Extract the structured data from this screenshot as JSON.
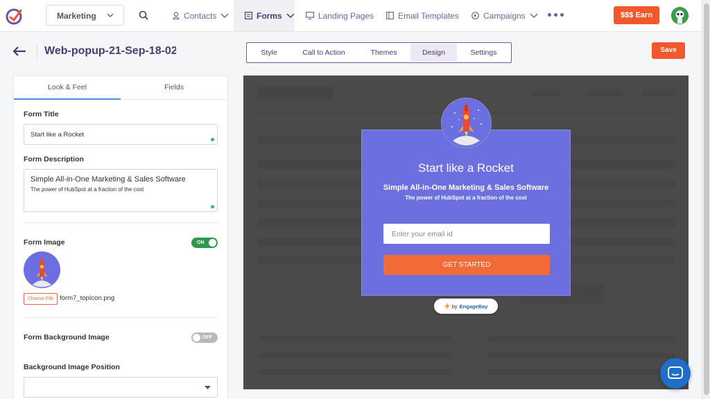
{
  "nav": {
    "workspace": "Marketing",
    "items": [
      {
        "label": "Contacts",
        "icon": "person-icon"
      },
      {
        "label": "Forms",
        "icon": "form-icon"
      },
      {
        "label": "Landing Pages",
        "icon": "monitor-icon"
      },
      {
        "label": "Email Templates",
        "icon": "template-icon"
      },
      {
        "label": "Campaigns",
        "icon": "campaign-icon"
      }
    ],
    "earn_label": "$$$ Earn"
  },
  "header": {
    "title": "Web-popup-21-Sep-18-02...",
    "tabs": [
      "Style",
      "Call to Action",
      "Themes",
      "Design",
      "Settings"
    ],
    "active_tab": "Design",
    "save_label": "Save"
  },
  "panel": {
    "tabs": [
      "Look & Feel",
      "Fields"
    ],
    "form_title_label": "Form Title",
    "form_title_value": "Start like a Rocket",
    "form_desc_label": "Form Description",
    "form_desc_line1": "Simple All-in-One Marketing & Sales Software",
    "form_desc_line2": "The power of HubSpot at a fraction of the cost",
    "form_image_label": "Form Image",
    "form_image_toggle": "ON",
    "choose_file_label": "Choose File",
    "file_name": "form7_topIcon.png",
    "bg_image_label": "Form Background Image",
    "bg_image_toggle": "OFF",
    "bg_position_label": "Background Image Position"
  },
  "popup": {
    "title": "Start like a Rocket",
    "subtitle": "Simple All-in-One Marketing & Sales Software",
    "description": "The power of HubSpot at a fraction of the cost",
    "email_placeholder": "Enter your email id",
    "button_label": "GET STARTED",
    "branding_prefix": "by",
    "branding_name": "EngageBay"
  },
  "colors": {
    "accent": "#f3582c",
    "brand": "#4b3a73",
    "popup_bg": "#6b6fe0",
    "toggle_on": "#2c9a4a"
  }
}
